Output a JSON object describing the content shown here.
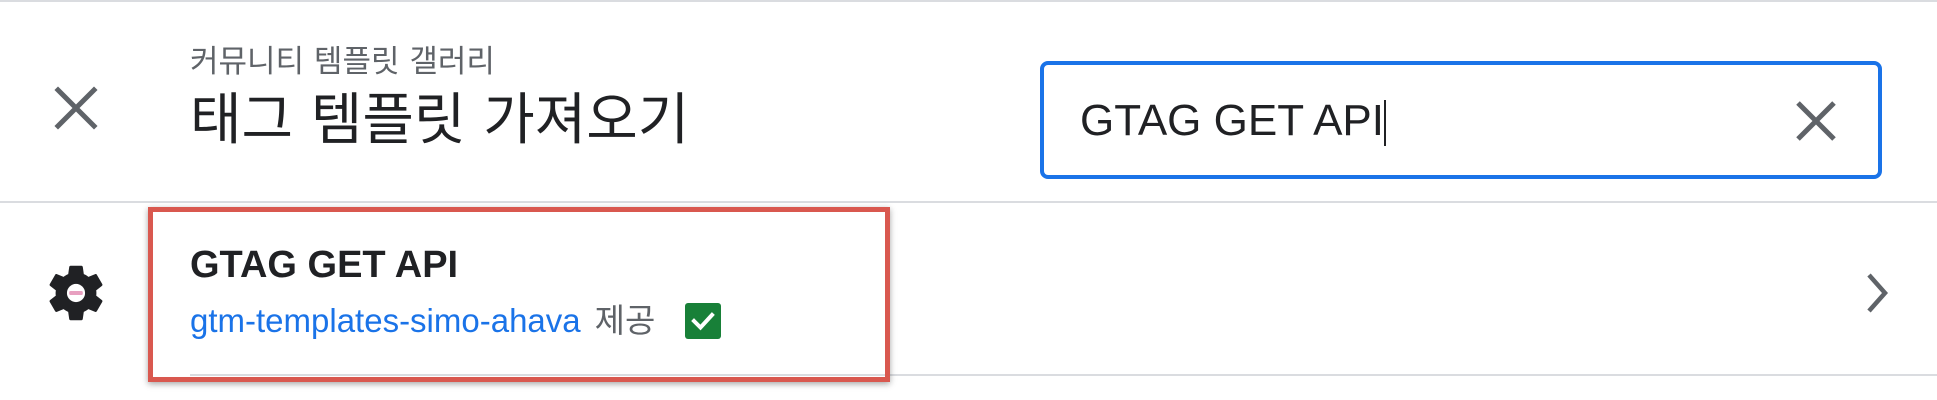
{
  "header": {
    "subtitle": "커뮤니티 템플릿 갤러리",
    "title": "태그 템플릿 가져오기",
    "close_icon": "close-icon"
  },
  "search": {
    "value": "GTAG GET API",
    "clear_icon": "clear-icon"
  },
  "results": [
    {
      "title": "GTAG GET API",
      "author": "gtm-templates-simo-ahava",
      "provided_label": "제공",
      "verified": true,
      "icon": "gear-icon",
      "chevron_icon": "chevron-right-icon"
    }
  ],
  "colors": {
    "accent": "#1a73e8",
    "verified": "#188038",
    "highlight": "#d9584f"
  }
}
